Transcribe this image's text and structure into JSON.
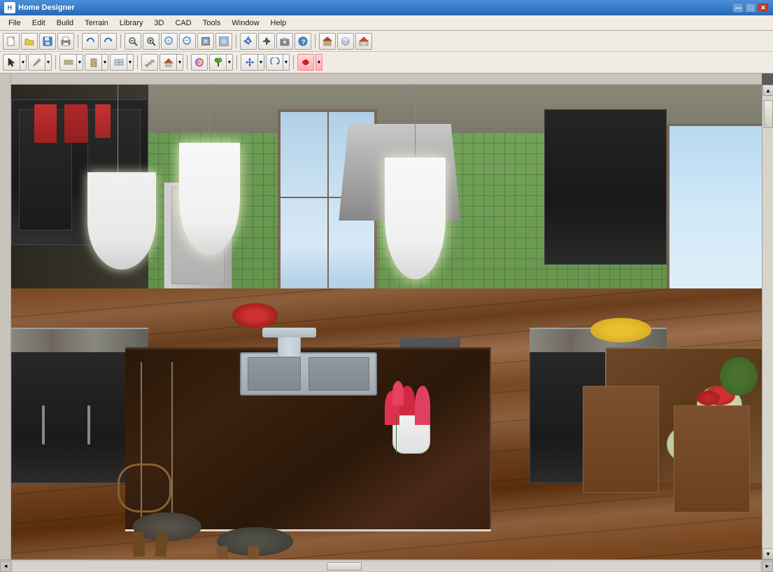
{
  "titleBar": {
    "title": "Home Designer",
    "icon": "H",
    "controls": {
      "minimize": "—",
      "maximize": "□",
      "close": "✕"
    }
  },
  "menuBar": {
    "items": [
      "File",
      "Edit",
      "Build",
      "Terrain",
      "Library",
      "3D",
      "CAD",
      "Tools",
      "Window",
      "Help"
    ]
  },
  "toolbar": {
    "row1": {
      "buttons": [
        {
          "id": "new",
          "icon": "📄",
          "label": "New"
        },
        {
          "id": "open",
          "icon": "📂",
          "label": "Open"
        },
        {
          "id": "save",
          "icon": "💾",
          "label": "Save"
        },
        {
          "id": "print",
          "icon": "🖨",
          "label": "Print"
        },
        {
          "id": "undo",
          "icon": "↩",
          "label": "Undo"
        },
        {
          "id": "redo",
          "icon": "↪",
          "label": "Redo"
        },
        {
          "id": "zoom-out",
          "icon": "🔍",
          "label": "Zoom Out"
        },
        {
          "id": "zoom-in-glass",
          "icon": "🔎",
          "label": "Zoom In"
        },
        {
          "id": "zoom-in",
          "icon": "+",
          "label": "Zoom In"
        },
        {
          "id": "zoom-out2",
          "icon": "−",
          "label": "Zoom Out"
        },
        {
          "id": "fit",
          "icon": "⊡",
          "label": "Fit"
        },
        {
          "id": "fit2",
          "icon": "⊞",
          "label": "Fit All"
        },
        {
          "id": "pan",
          "icon": "✋",
          "label": "Pan"
        },
        {
          "id": "sep1",
          "type": "sep"
        },
        {
          "id": "arrow-up",
          "icon": "↑",
          "label": "Up"
        },
        {
          "id": "arrow",
          "icon": "→",
          "label": "Arrow"
        },
        {
          "id": "cam",
          "icon": "📷",
          "label": "Camera"
        },
        {
          "id": "question",
          "icon": "?",
          "label": "Help"
        },
        {
          "id": "sep2",
          "type": "sep"
        },
        {
          "id": "house1",
          "icon": "🏠",
          "label": "House"
        },
        {
          "id": "house2",
          "icon": "🏡",
          "label": "House 2"
        },
        {
          "id": "house3",
          "icon": "🏘",
          "label": "House 3"
        }
      ]
    },
    "row2": {
      "buttons": [
        {
          "id": "select",
          "icon": "↖",
          "label": "Select"
        },
        {
          "id": "draw",
          "icon": "✏",
          "label": "Draw"
        },
        {
          "id": "measure",
          "icon": "📏",
          "label": "Measure"
        },
        {
          "id": "wall",
          "icon": "▦",
          "label": "Wall"
        },
        {
          "id": "door",
          "icon": "🚪",
          "label": "Door"
        },
        {
          "id": "window",
          "icon": "🪟",
          "label": "Window"
        },
        {
          "id": "stair",
          "icon": "🪜",
          "label": "Stair"
        },
        {
          "id": "roof",
          "icon": "🏗",
          "label": "Roof"
        },
        {
          "id": "terrain",
          "icon": "⛰",
          "label": "Terrain"
        },
        {
          "id": "material",
          "icon": "🎨",
          "label": "Material"
        },
        {
          "id": "plant",
          "icon": "🌿",
          "label": "Plant"
        },
        {
          "id": "arrow-group",
          "icon": "↕",
          "label": "Arrow Group"
        },
        {
          "id": "move",
          "icon": "✢",
          "label": "Move"
        },
        {
          "id": "rec",
          "icon": "⏺",
          "label": "Record"
        }
      ]
    }
  },
  "canvas": {
    "alt": "3D Kitchen Design View",
    "description": "Interior kitchen 3D rendering showing dark cabinets, green tile backsplash, island with sink, pendant lights, hardwood floors"
  },
  "scrollbar": {
    "upArrow": "▲",
    "downArrow": "▼",
    "leftArrow": "◄",
    "rightArrow": "►"
  }
}
